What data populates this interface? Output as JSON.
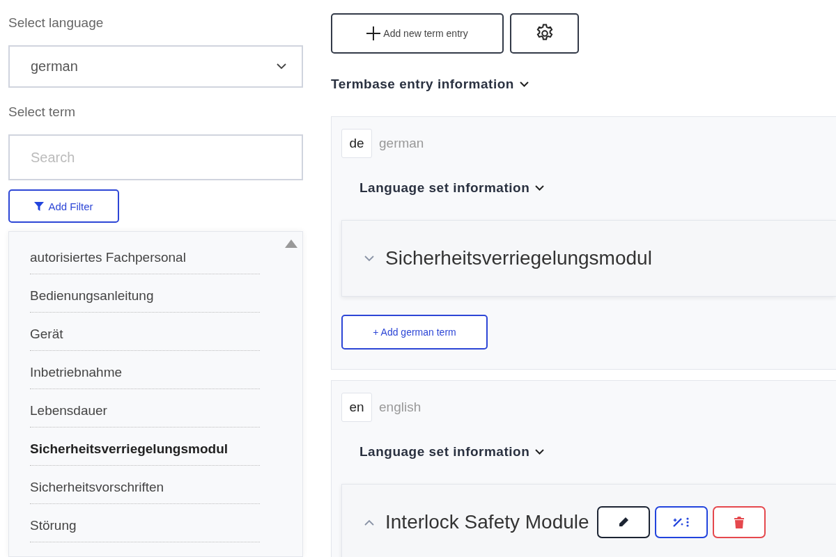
{
  "sidebar": {
    "language_label": "Select language",
    "language_select": {
      "value": "german"
    },
    "term_label": "Select term",
    "search": {
      "placeholder": "Search"
    },
    "filter_button": "Add Filter",
    "terms": [
      {
        "label": "autorisiertes Fachpersonal",
        "selected": false
      },
      {
        "label": "Bedienungsanleitung",
        "selected": false
      },
      {
        "label": "Gerät",
        "selected": false
      },
      {
        "label": "Inbetriebnahme",
        "selected": false
      },
      {
        "label": "Lebensdauer",
        "selected": false
      },
      {
        "label": "Sicherheitsverriegelungsmodul",
        "selected": true
      },
      {
        "label": "Sicherheitsvorschriften",
        "selected": false
      },
      {
        "label": "Störung",
        "selected": false
      }
    ]
  },
  "toolbar": {
    "add_button": "Add new term entry"
  },
  "entry_info": "Termbase entry information",
  "language_sets": [
    {
      "code": "de",
      "name": "german",
      "info": "Language set information",
      "terms": [
        {
          "text": "Sicherheitsverriegelungsmodul",
          "expanded": false
        }
      ],
      "add_button": "+ Add german term"
    },
    {
      "code": "en",
      "name": "english",
      "info": "Language set information",
      "terms": [
        {
          "text": "Interlock Safety Module",
          "expanded": true,
          "actions": [
            {
              "kind": "edit"
            },
            {
              "kind": "magic"
            },
            {
              "kind": "delete"
            }
          ]
        }
      ]
    }
  ]
}
